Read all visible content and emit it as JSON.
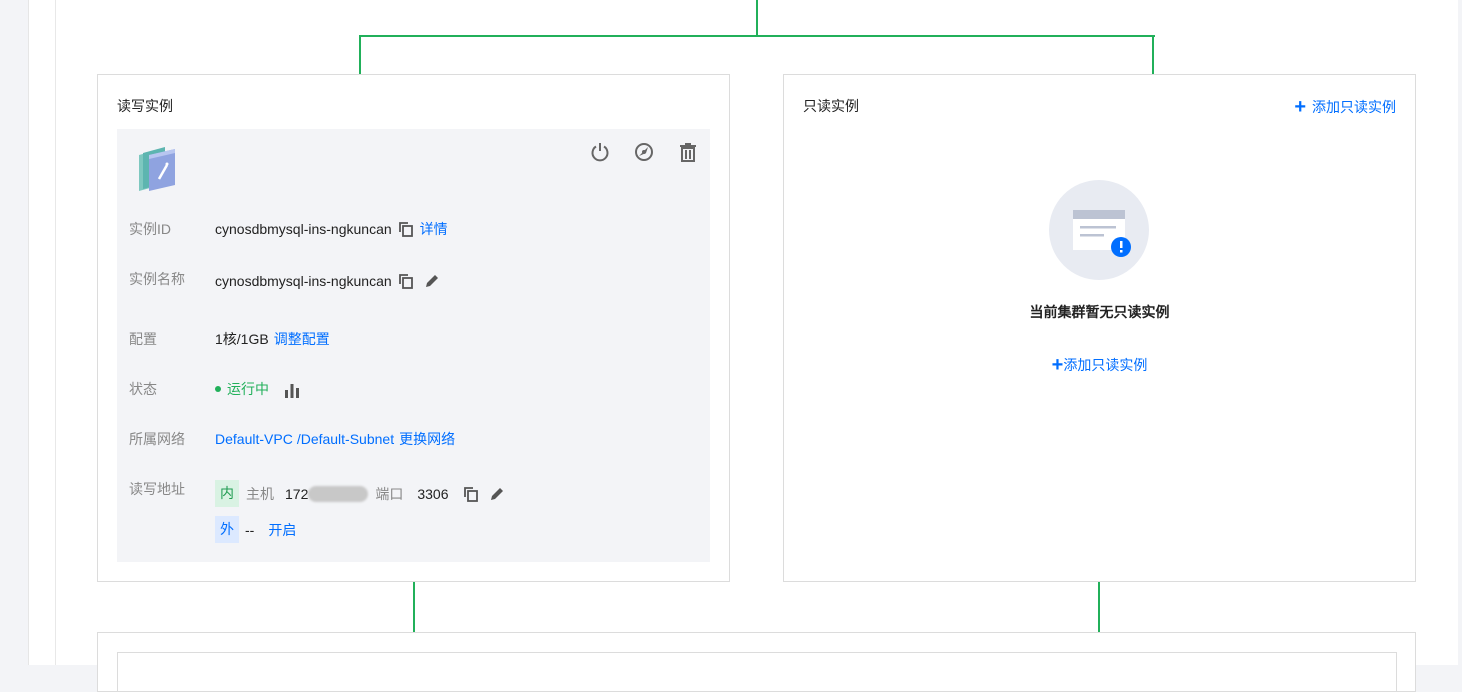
{
  "rw_card": {
    "title": "读写实例",
    "instance_id_label": "实例ID",
    "instance_id": "cynosdbmysql-ins-ngkuncan",
    "detail_link": "详情",
    "instance_name_label": "实例名称",
    "instance_name": "cynosdbmysql-ins-ngkuncan",
    "config_label": "配置",
    "config_value": "1核/1GB",
    "adjust_config_link": "调整配置",
    "status_label": "状态",
    "status_value": "运行中",
    "network_label": "所属网络",
    "vpc": "Default-VPC",
    "subnet": "/Default-Subnet",
    "change_network_link": "更换网络",
    "address_label": "读写地址",
    "inner_tag": "内",
    "host_label": "主机",
    "host_prefix": "172",
    "port_label": "端口",
    "port_value": "3306",
    "outer_tag": "外",
    "outer_value": "--",
    "enable_link": "开启"
  },
  "ro_card": {
    "title": "只读实例",
    "add_link_top": "添加只读实例",
    "empty_text": "当前集群暂无只读实例",
    "add_link_center": "添加只读实例"
  },
  "colors": {
    "accent": "#006eff",
    "connector": "#21b05a",
    "running": "#21b05a"
  }
}
